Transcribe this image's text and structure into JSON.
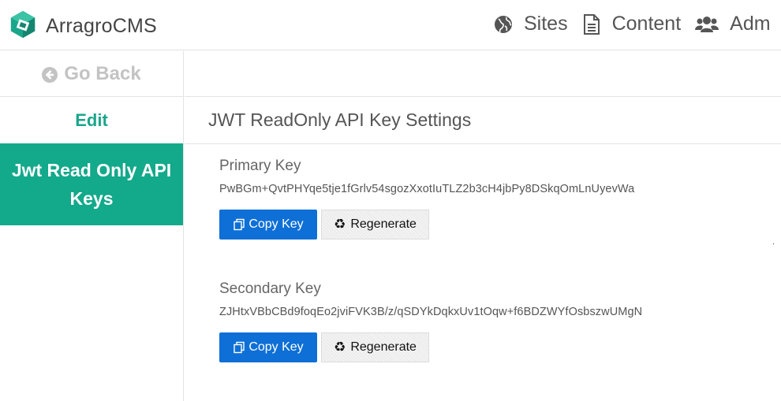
{
  "app": {
    "brand_name": "ArragroCMS"
  },
  "nav": {
    "items": [
      {
        "label": "Sites",
        "icon": "globe-icon"
      },
      {
        "label": "Content",
        "icon": "document-icon"
      },
      {
        "label": "Adm",
        "icon": "users-icon"
      }
    ]
  },
  "sidebar": {
    "go_back": "Go Back",
    "edit": "Edit",
    "active_item": "Jwt Read Only API Keys"
  },
  "main": {
    "section_title": "JWT ReadOnly API Key Settings",
    "keys": [
      {
        "label": "Primary Key",
        "value": "PwBGm+QvtPHYqe5tje1fGrlv54sgozXxotIuTLZ2b3cH4jbPy8DSkqOmLnUyevWa",
        "copy_label": "Copy Key",
        "regen_label": "Regenerate"
      },
      {
        "label": "Secondary Key",
        "value": "ZJHtxVBbCBd9foqEo2jviFVK3B/z/qSDYkDqkxUv1tOqw+f6BDZWYfOsbszwUMgN",
        "copy_label": "Copy Key",
        "regen_label": "Regenerate"
      }
    ]
  },
  "colors": {
    "accent": "#13a98b",
    "primary_button": "#0e6fd6"
  }
}
